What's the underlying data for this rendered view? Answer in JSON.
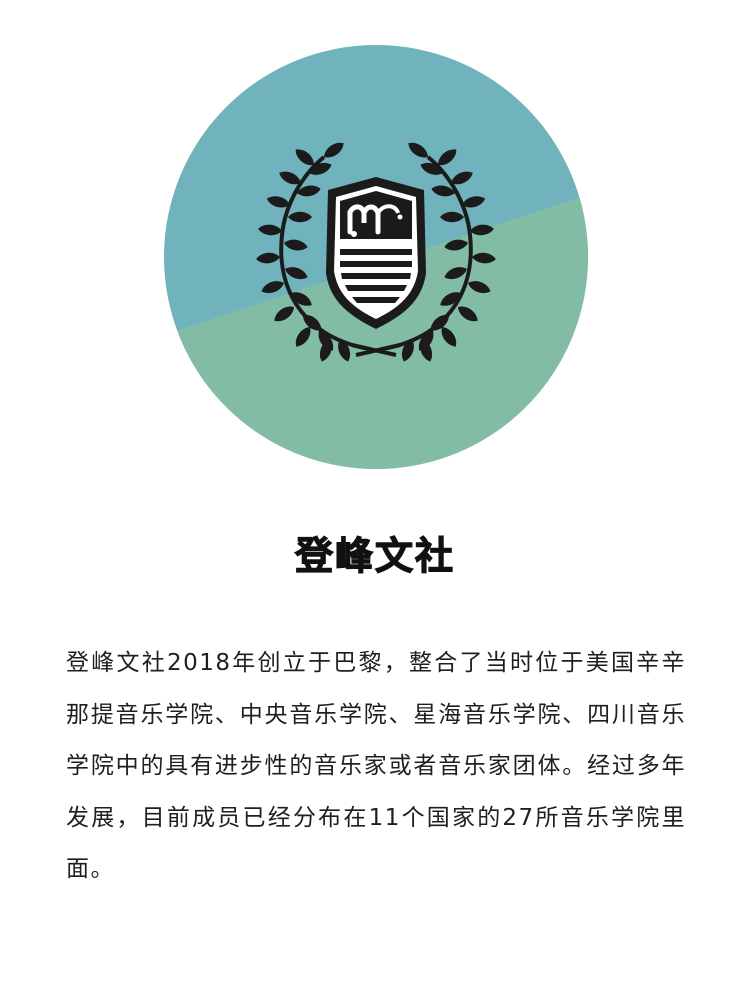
{
  "club": {
    "name": "登峰文社",
    "description": "登峰文社2018年创立于巴黎，整合了当时位于美国辛辛那提音乐学院、中央音乐学院、星海音乐学院、四川音乐学院中的具有进步性的音乐家或者音乐家团体。经过多年发展，目前成员已经分布在11个国家的27所音乐学院里面。"
  },
  "logo": {
    "icon": "laurel-crest-emblem",
    "colors": {
      "upper": "#70b3bc",
      "lower": "#82bca5",
      "emblem": "#1c1b1b"
    }
  }
}
